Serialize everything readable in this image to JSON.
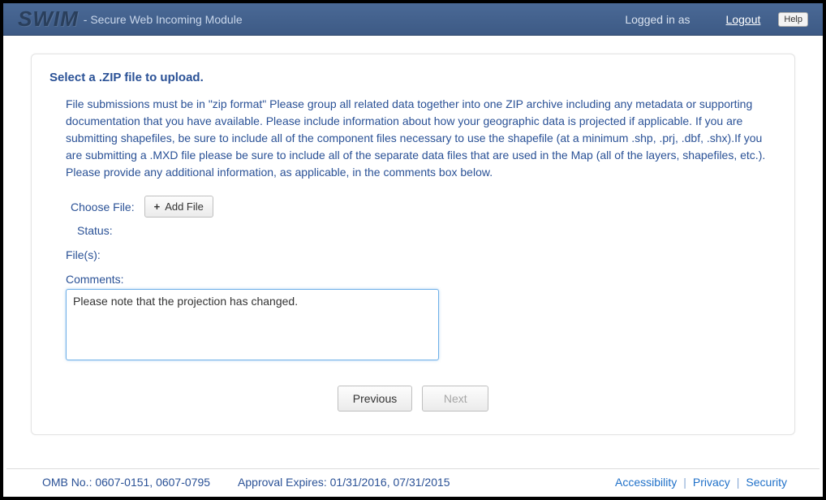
{
  "header": {
    "logo": "SWIM",
    "subtitle": "- Secure Web Incoming Module",
    "logged_in_label": "Logged in as",
    "logged_in_user": "",
    "logout_label": "Logout",
    "help_label": "Help"
  },
  "main": {
    "section_title": "Select a .ZIP file to upload.",
    "instructions": "File submissions must be in \"zip format\" Please group all related data together into one ZIP archive including any metadata or supporting documentation that you have available. Please include information about how your geographic data is projected if applicable. If you are submitting shapefiles, be sure to include all of the component files necessary to use the shapefile (at a minimum .shp, .prj, .dbf, .shx).If you are submitting a .MXD file please be sure to include all of the separate data files that are used in the Map (all of the layers, shapefiles, etc.). Please provide any additional information, as applicable, in the comments box below.",
    "choose_file_label": "Choose File:",
    "add_file_label": "Add File",
    "status_label": "Status:",
    "status_value": "",
    "files_label": "File(s):",
    "comments_label": "Comments:",
    "comments_value": "Please note that the projection has changed.",
    "previous_label": "Previous",
    "next_label": "Next"
  },
  "footer": {
    "omb": "OMB No.: 0607-0151, 0607-0795",
    "approval": "Approval Expires: 01/31/2016, 07/31/2015",
    "links": {
      "accessibility": "Accessibility",
      "privacy": "Privacy",
      "security": "Security"
    }
  }
}
